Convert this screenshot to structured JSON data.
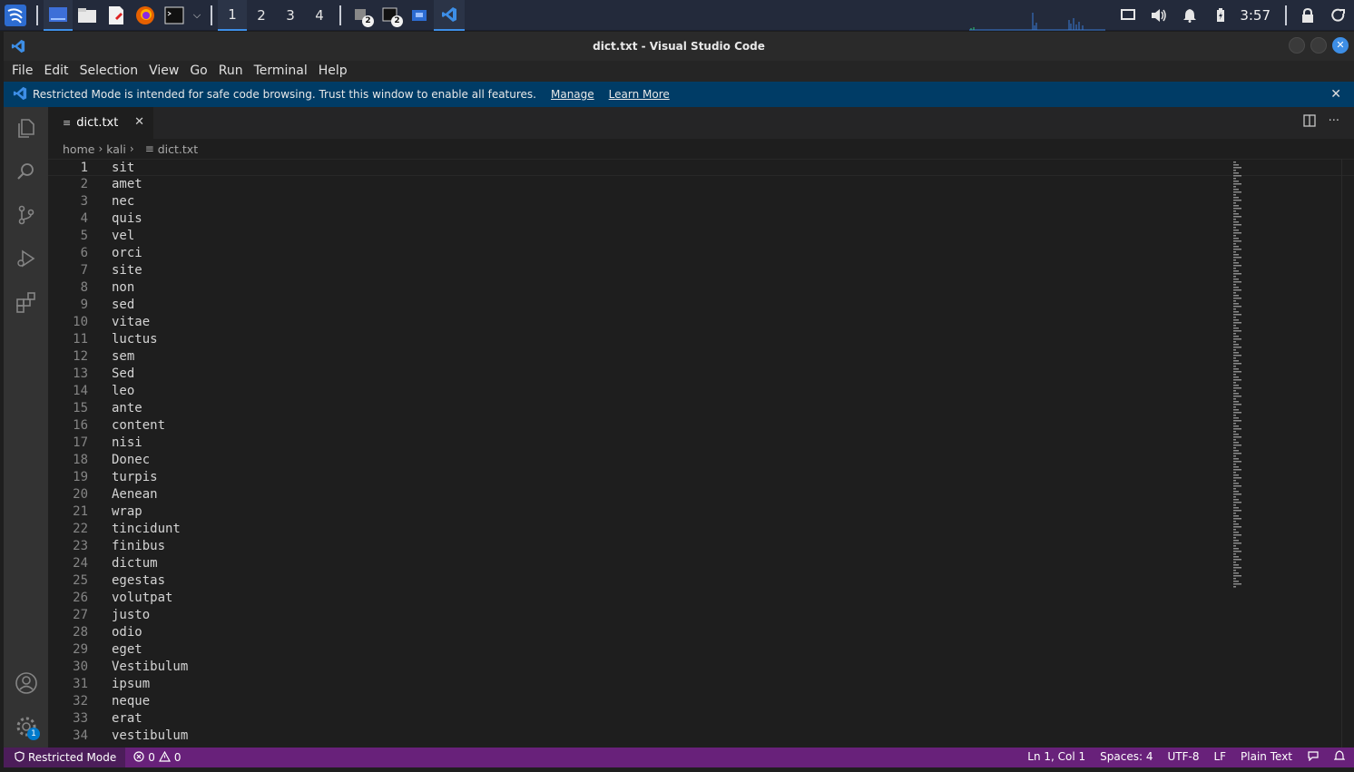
{
  "taskbar": {
    "workspaces": [
      "1",
      "2",
      "3",
      "4"
    ],
    "active_workspace": "1",
    "badge_a": "2",
    "badge_b": "2",
    "clock": "3:57"
  },
  "window": {
    "title": "dict.txt - Visual Studio Code"
  },
  "menu": [
    "File",
    "Edit",
    "Selection",
    "View",
    "Go",
    "Run",
    "Terminal",
    "Help"
  ],
  "banner": {
    "message": "Restricted Mode is intended for safe code browsing. Trust this window to enable all features.",
    "manage": "Manage",
    "learn_more": "Learn More"
  },
  "tab": {
    "label": "dict.txt"
  },
  "breadcrumbs": [
    "home",
    "kali",
    "dict.txt"
  ],
  "activity": {
    "settings_badge": "1"
  },
  "editor": {
    "lines": [
      "sit",
      "amet",
      "nec",
      "quis",
      "vel",
      "orci",
      "site",
      "non",
      "sed",
      "vitae",
      "luctus",
      "sem",
      "Sed",
      "leo",
      "ante",
      "content",
      "nisi",
      "Donec",
      "turpis",
      "Aenean",
      "wrap",
      "tincidunt",
      "finibus",
      "dictum",
      "egestas",
      "volutpat",
      "justo",
      "odio",
      "eget",
      "Vestibulum",
      "ipsum",
      "neque",
      "erat",
      "vestibulum"
    ]
  },
  "status": {
    "restricted": "Restricted Mode",
    "errors": "0",
    "warnings": "0",
    "position": "Ln 1, Col 1",
    "spaces": "Spaces: 4",
    "encoding": "UTF-8",
    "eol": "LF",
    "language": "Plain Text"
  },
  "colors": {
    "banner_bg": "#003c66",
    "status_bg": "#68217a",
    "accent": "#3d8ee6"
  }
}
